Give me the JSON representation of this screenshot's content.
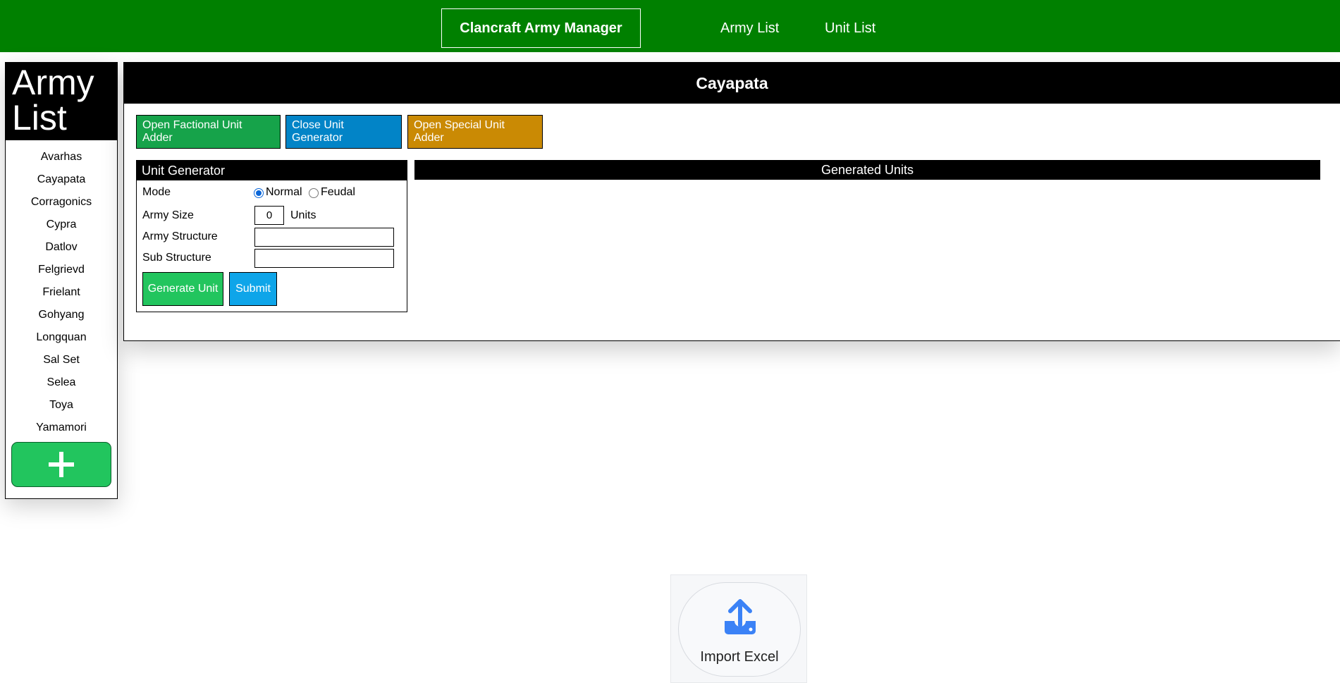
{
  "nav": {
    "brand": "Clancraft Army Manager",
    "links": [
      "Army List",
      "Unit List"
    ]
  },
  "sidebar": {
    "title_line1": "Army",
    "title_line2": "List",
    "items": [
      "Avarhas",
      "Cayapata",
      "Corragonics",
      "Cypra",
      "Datlov",
      "Felgrievd",
      "Frielant",
      "Gohyang",
      "Longquan",
      "Sal Set",
      "Selea",
      "Toya",
      "Yamamori"
    ],
    "add_icon": "plus-icon"
  },
  "main": {
    "title": "Cayapata",
    "buttons": {
      "factional": "Open Factional Unit Adder",
      "close_generator": "Close Unit Generator",
      "special": "Open Special Unit Adder"
    },
    "generator": {
      "header": "Unit Generator",
      "mode_label": "Mode",
      "mode_options": [
        "Normal",
        "Feudal"
      ],
      "mode_selected": "Normal",
      "army_size_label": "Army Size",
      "army_size_value": "0",
      "army_size_unit": "Units",
      "army_structure_label": "Army Structure",
      "army_structure_value": "",
      "sub_structure_label": "Sub Structure",
      "sub_structure_value": "",
      "generate_label": "Generate Unit",
      "submit_label": "Submit"
    },
    "generated_header": "Generated Units"
  },
  "import": {
    "label": "Import Excel",
    "icon": "upload-icon"
  },
  "colors": {
    "nav_bg": "#008000",
    "factional": "#16a34a",
    "close_generator": "#0284c7",
    "special": "#ca8a04",
    "generate": "#22c55e",
    "submit": "#0ea5e9",
    "upload_icon": "#3b82f6"
  }
}
